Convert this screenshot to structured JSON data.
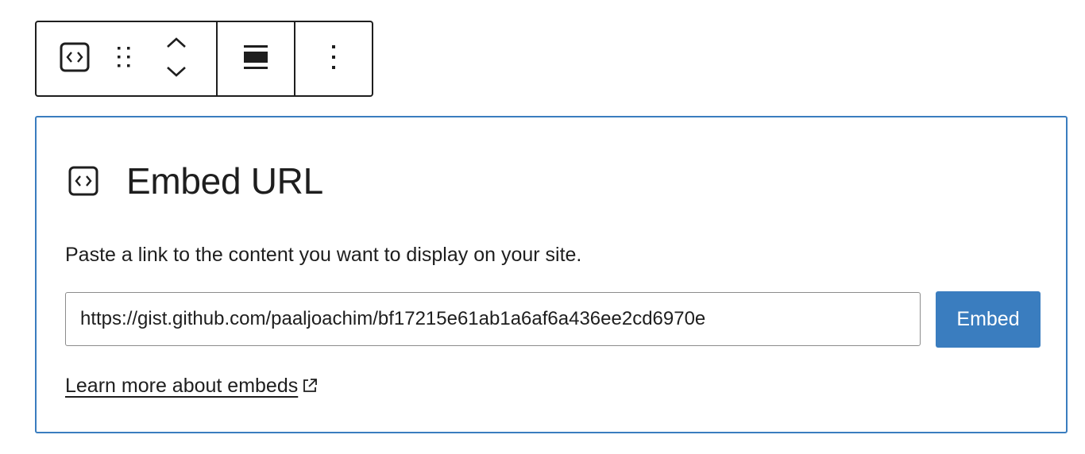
{
  "toolbar": {
    "buttons": [
      {
        "icon": "embed-block-icon",
        "action": "Change block type"
      },
      {
        "icon": "drag-handle-icon",
        "action": "Drag"
      },
      {
        "icon": "chevron-up-icon",
        "action": "Move up"
      },
      {
        "icon": "chevron-down-icon",
        "action": "Move down"
      },
      {
        "icon": "align-wide-icon",
        "action": "Align"
      },
      {
        "icon": "more-vertical-icon",
        "action": "Options"
      }
    ]
  },
  "placeholder": {
    "icon": "embed-block-icon",
    "title": "Embed URL",
    "instructions": "Paste a link to the content you want to display on your site.",
    "url_value": "https://gist.github.com/paaljoachim/bf17215e61ab1a6af6a436ee2cd6970e",
    "embed_button_label": "Embed",
    "learn_more_label": "Learn more about embeds",
    "learn_more_icon": "external-link-icon"
  },
  "colors": {
    "accent": "#3a7dbf",
    "text": "#1e1e1e",
    "border": "#8c8c8c"
  }
}
